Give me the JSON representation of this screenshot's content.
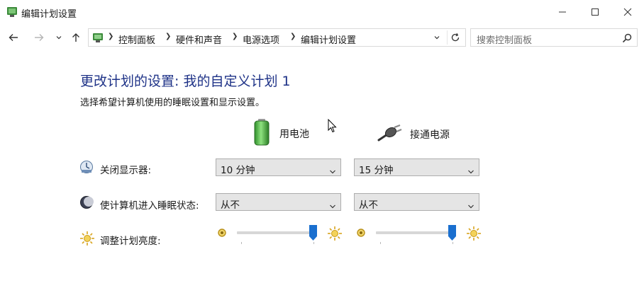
{
  "window": {
    "title": "编辑计划设置"
  },
  "address": {
    "crumbs": [
      "控制面板",
      "硬件和声音",
      "电源选项",
      "编辑计划设置"
    ]
  },
  "search": {
    "placeholder": "搜索控制面板"
  },
  "page": {
    "heading": "更改计划的设置: 我的自定义计划 1",
    "subtext": "选择希望计算机使用的睡眠设置和显示设置。"
  },
  "columns": {
    "battery": "用电池",
    "plugged": "接通电源"
  },
  "rows": {
    "display": {
      "label": "关闭显示器:",
      "battery_value": "10 分钟",
      "plugged_value": "15 分钟"
    },
    "sleep": {
      "label": "使计算机进入睡眠状态:",
      "battery_value": "从不",
      "plugged_value": "从不"
    },
    "brightness": {
      "label": "调整计划亮度:",
      "battery_level": 1.0,
      "plugged_level": 1.0
    }
  },
  "colors": {
    "heading": "#1e3287",
    "slider_thumb": "#1a6fcf",
    "sun": "#d9a520"
  },
  "icons": {
    "app": "power-plan-icon",
    "back": "back-arrow-icon",
    "forward": "forward-arrow-icon",
    "recent": "chevron-down-icon",
    "up": "up-arrow-icon",
    "refresh": "refresh-icon",
    "search": "search-icon",
    "battery": "battery-icon",
    "plug": "plug-icon",
    "monitor": "monitor-icon",
    "moon": "moon-icon",
    "sun": "sun-icon"
  }
}
